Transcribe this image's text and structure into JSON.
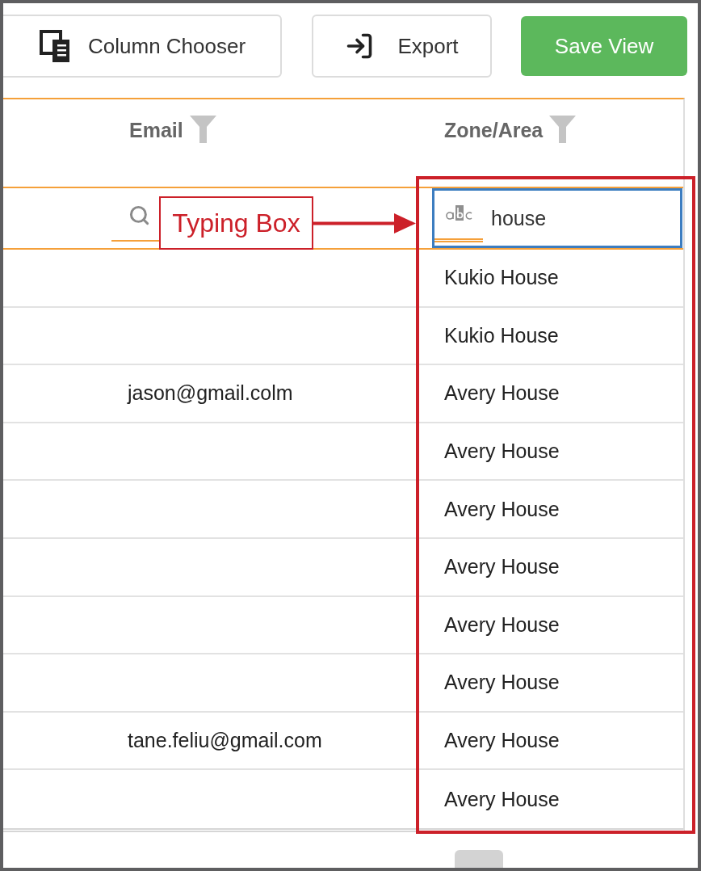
{
  "toolbar": {
    "buttons": [
      {
        "label": "Column Chooser",
        "kind": "chooser"
      },
      {
        "label": "Export",
        "kind": "export"
      },
      {
        "label": "Save View",
        "kind": "primary"
      }
    ]
  },
  "grid": {
    "columns": [
      {
        "label": "Email",
        "filter": {
          "kind": "search",
          "focused": false
        }
      },
      {
        "label": "Zone/Area",
        "filter": {
          "kind": "text",
          "value": "house",
          "focused": true
        }
      }
    ],
    "rows": [
      {
        "zone_area": "Kukio House"
      },
      {
        "zone_area": "Kukio House"
      },
      {
        "email": "jason@gmail.colm",
        "zone_area": "Avery House"
      },
      {
        "zone_area": "Avery House"
      },
      {
        "zone_area": "Avery House"
      },
      {
        "zone_area": "Avery House"
      },
      {
        "zone_area": "Avery House"
      },
      {
        "zone_area": "Avery House"
      },
      {
        "email": "tane.feliu@gmail.com",
        "zone_area": "Avery House"
      },
      {
        "zone_area": "Avery House"
      }
    ]
  },
  "annotation": {
    "label": "Typing Box"
  }
}
